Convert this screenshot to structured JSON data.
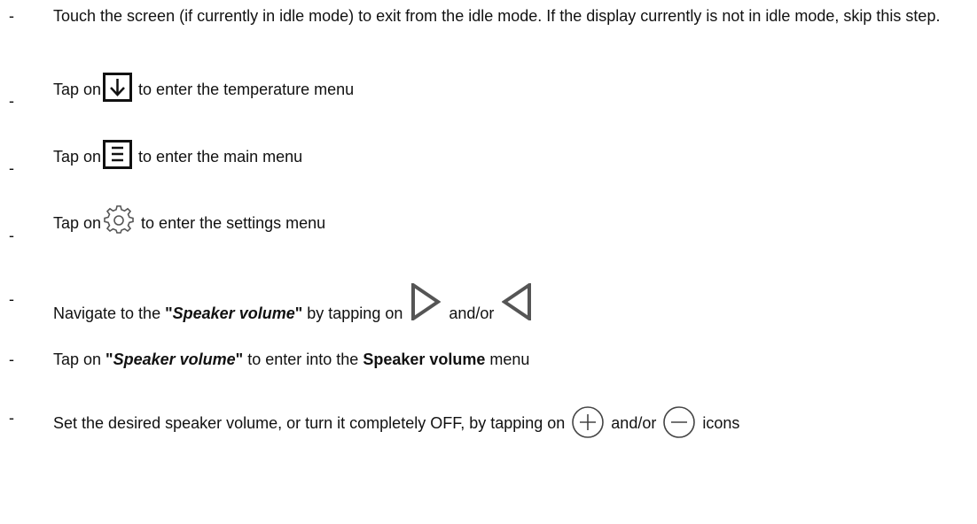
{
  "bullet": "-",
  "steps": {
    "s1": {
      "text": "Touch the screen (if currently in idle mode) to exit from the idle mode. If the display currently is not in idle mode, skip this step."
    },
    "s2": {
      "pre": "Tap on",
      "post": " to enter the temperature menu",
      "icon": "arrow-down-box-icon"
    },
    "s3": {
      "pre": "Tap on",
      "post": " to enter the main menu",
      "icon": "hamburger-menu-box-icon"
    },
    "s4": {
      "pre": "Tap on",
      "post": " to enter the settings menu",
      "icon": "gear-icon"
    },
    "s5": {
      "pre": "Navigate to the ",
      "quote_open": "\"",
      "bold_italic": "Speaker volume",
      "quote_close": "\"",
      "mid": " by tapping on ",
      "andor": " and/or ",
      "icons": [
        "triangle-right-icon",
        "triangle-left-icon"
      ]
    },
    "s6": {
      "pre": "Tap on ",
      "quote_open": "\"",
      "bold_italic": "Speaker volume",
      "quote_close": "\"",
      "mid": " to enter into the ",
      "bold": "Speaker volume",
      "post": " menu"
    },
    "s7": {
      "pre": "Set the desired speaker volume, or turn it completely OFF, by tapping on ",
      "andor": " and/or ",
      "post": " icons",
      "icons": [
        "plus-circle-icon",
        "minus-circle-icon"
      ]
    }
  }
}
